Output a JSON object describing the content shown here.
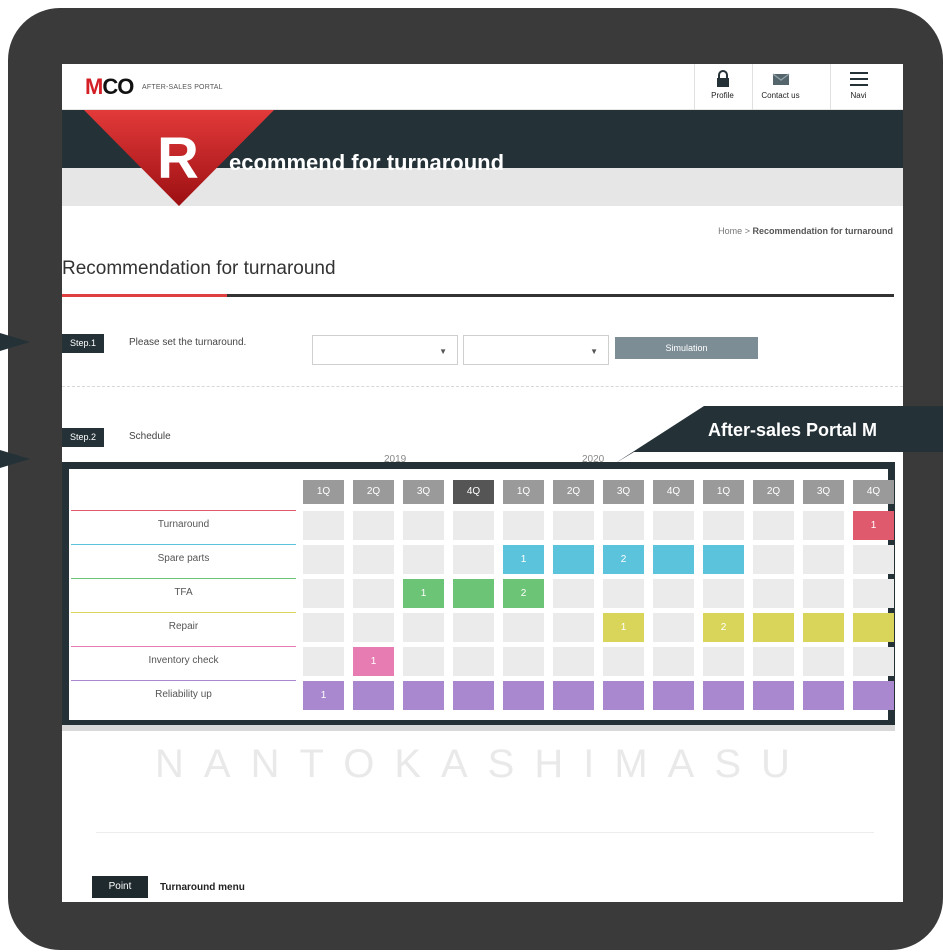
{
  "header": {
    "logo_main": "MCO",
    "logo_sub": "AFTER-SALES PORTAL",
    "nav": [
      {
        "label": "Profile",
        "icon": "lock-icon"
      },
      {
        "label": "Contact us",
        "icon": "mail-icon"
      },
      {
        "label": "Navi",
        "icon": "hamburger-menu-icon"
      }
    ]
  },
  "hero": {
    "letter": "R",
    "title": "ecommend for turnaround"
  },
  "breadcrumb": {
    "home": "Home",
    "separator": ">",
    "current": "Recommendation for turnaround"
  },
  "page_title": "Recommendation for turnaround",
  "step1": {
    "tag": "Step.1",
    "text": "Please set the turnaround.",
    "select1_value": "",
    "select2_value": "",
    "button": "Simulation"
  },
  "step2": {
    "tag": "Step.2",
    "text": "Schedule"
  },
  "schedule": {
    "years": [
      "2019",
      "2020"
    ],
    "quarters": [
      "1Q",
      "2Q",
      "3Q",
      "4Q",
      "1Q",
      "2Q",
      "3Q",
      "4Q",
      "1Q",
      "2Q",
      "3Q",
      "4Q"
    ],
    "highlight_quarter_index": 3,
    "rows": [
      {
        "label": "Turnaround",
        "color": "#e05a6e",
        "cells": [
          "",
          "",
          "",
          "",
          "",
          "",
          "",
          "",
          "",
          "",
          "",
          "1"
        ],
        "filled": [
          11
        ]
      },
      {
        "label": "Spare parts",
        "color": "#5bc3dc",
        "cells": [
          "",
          "",
          "",
          "",
          "1",
          "",
          "2",
          "",
          "",
          "",
          "",
          ""
        ],
        "filled": [
          4,
          5,
          6,
          7,
          8
        ]
      },
      {
        "label": "TFA",
        "color": "#6cc476",
        "cells": [
          "",
          "",
          "1",
          "",
          "2",
          "",
          "",
          "",
          "",
          "",
          "",
          ""
        ],
        "filled": [
          2,
          3,
          4
        ]
      },
      {
        "label": "Repair",
        "color": "#d9d55a",
        "cells": [
          "",
          "",
          "",
          "",
          "",
          "",
          "1",
          "",
          "2",
          "",
          "",
          ""
        ],
        "filled": [
          6,
          8,
          9,
          10,
          11
        ]
      },
      {
        "label": "Inventory check",
        "color": "#e77cb2",
        "cells": [
          "",
          "1",
          "",
          "",
          "",
          "",
          "",
          "",
          "",
          "",
          "",
          ""
        ],
        "filled": [
          1
        ]
      },
      {
        "label": "Reliability up",
        "color": "#a988d0",
        "cells": [
          "1",
          "",
          "",
          "",
          "",
          "",
          "",
          "",
          "",
          "",
          "",
          ""
        ],
        "filled": [
          0,
          1,
          2,
          3,
          4,
          5,
          6,
          7,
          8,
          9,
          10,
          11
        ]
      }
    ]
  },
  "watermark": "NANTOKASHIMASU",
  "callout": "After-sales Portal M",
  "point": {
    "tag": "Point",
    "text": "Turnaround menu"
  },
  "colors": {
    "brand_red": "#d41f26",
    "dark_navy": "#243238",
    "frame": "#3a3a3a"
  }
}
